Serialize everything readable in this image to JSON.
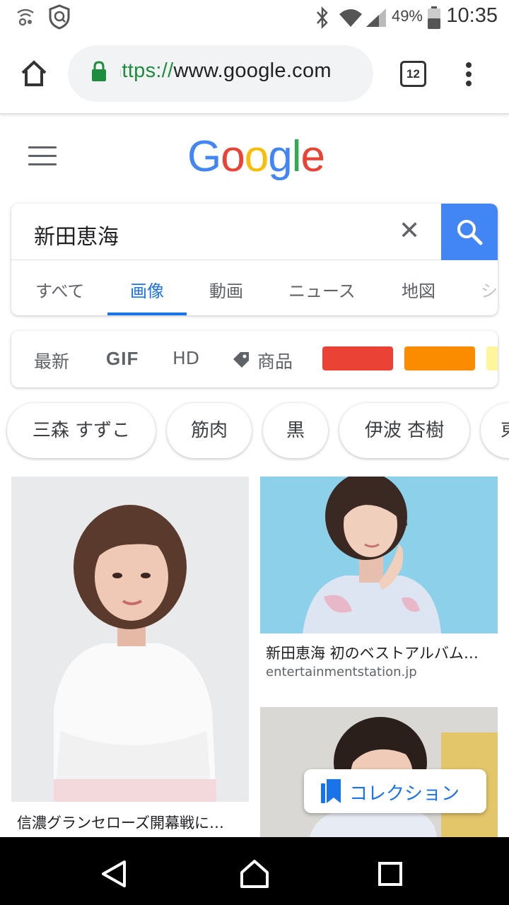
{
  "status_bar": {
    "battery": "49%",
    "time": "10:35"
  },
  "browser": {
    "url_scheme": "https://",
    "url_host": "www.google.com",
    "tab_count": "12"
  },
  "logo": [
    "G",
    "o",
    "o",
    "g",
    "l",
    "e"
  ],
  "search": {
    "query": "新田恵海",
    "clear_symbol": "✕",
    "tabs": [
      "すべて",
      "画像",
      "動画",
      "ニュース",
      "地図",
      "シ"
    ],
    "active_tab": "画像"
  },
  "filters": {
    "latest": "最新",
    "gif": "GIF",
    "hd": "HD",
    "products": "商品",
    "color_swatches": [
      "#ea4335",
      "#fb8c00",
      "#fff59d"
    ]
  },
  "suggestions": [
    "三森 すずこ",
    "筋肉",
    "黒",
    "伊波 杏樹",
    "東"
  ],
  "results": {
    "left_title": "信濃グランセローズ開幕戦に…",
    "right_title": "新田恵海 初のベストアルバム…",
    "right_source": "entertainmentstation.jp"
  },
  "collection_button": "コレクション",
  "colors": {
    "accent_blue": "#1a73e8",
    "search_button": "#4285f4",
    "logo": [
      "#4285f4",
      "#ea4335",
      "#fbbc05",
      "#4285f4",
      "#34a853",
      "#ea4335"
    ]
  }
}
